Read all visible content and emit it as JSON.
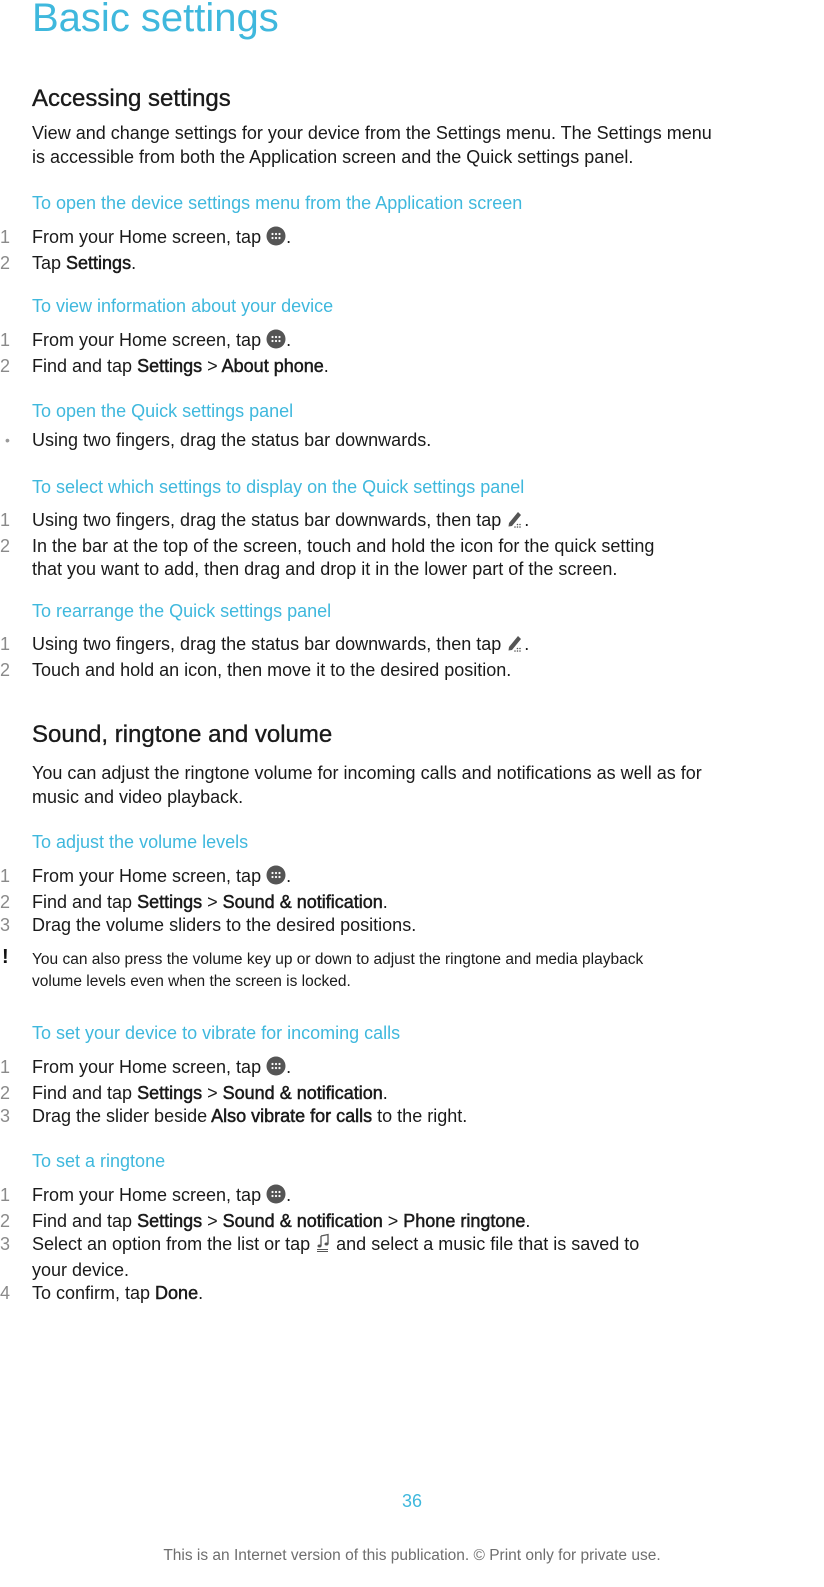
{
  "page": {
    "title": "Basic settings",
    "page_number": "36",
    "footer_note": "This is an Internet version of this publication. © Print only for private use."
  },
  "accessing": {
    "heading": "Accessing settings",
    "intro_line1": "View and change settings for your device from the Settings menu. The Settings menu",
    "intro_line2": "is accessible from both the Application screen and the Quick settings panel.",
    "procedures": [
      {
        "title": "To open the device settings menu from the Application screen",
        "steps": [
          {
            "num": "1",
            "text": "From your Home screen, tap ",
            "icon": "apps-grid-icon",
            "after": "."
          },
          {
            "num": "2",
            "pre": "Tap ",
            "bold": "Settings",
            "post": "."
          }
        ]
      },
      {
        "title": "To view information about your device",
        "steps": [
          {
            "num": "1",
            "text": "From your Home screen, tap ",
            "icon": "apps-grid-icon",
            "after": "."
          },
          {
            "num": "2",
            "pre": "Find and tap ",
            "bold": "Settings",
            "sep": " > ",
            "bold2": "About phone",
            "post": "."
          }
        ]
      },
      {
        "title": "To open the Quick settings panel",
        "bullet": "•",
        "steps": [
          {
            "text": "Using two fingers, drag the status bar downwards."
          }
        ]
      },
      {
        "title": "To select which settings to display on the Quick settings panel",
        "steps": [
          {
            "num": "1",
            "text": "Using two fingers, drag the status bar downwards, then tap ",
            "icon": "edit-pencil-icon",
            "after": "."
          },
          {
            "num": "2",
            "line1": "In the bar at the top of the screen, touch and hold the icon for the quick setting",
            "line2": "that you want to add, then drag and drop it in the lower part of the screen."
          }
        ]
      },
      {
        "title": "To rearrange the Quick settings panel",
        "steps": [
          {
            "num": "1",
            "text": "Using two fingers, drag the status bar downwards, then tap ",
            "icon": "edit-pencil-icon",
            "after": "."
          },
          {
            "num": "2",
            "text": "Touch and hold an icon, then move it to the desired position."
          }
        ]
      }
    ]
  },
  "sound": {
    "heading": "Sound, ringtone and volume",
    "intro_line1": "You can adjust the ringtone volume for incoming calls and notifications as well as for",
    "intro_line2": "music and video playback.",
    "procedures": [
      {
        "title": "To adjust the volume levels",
        "steps": [
          {
            "num": "1",
            "text": "From your Home screen, tap ",
            "icon": "apps-grid-icon",
            "after": "."
          },
          {
            "num": "2",
            "pre": "Find and tap ",
            "bold": "Settings",
            "sep": " > ",
            "bold2": "Sound & notification",
            "post": "."
          },
          {
            "num": "3",
            "text": "Drag the volume sliders to the desired positions."
          }
        ],
        "note": {
          "icon": "!",
          "line1": "You can also press the volume key up or down to adjust the ringtone and media playback",
          "line2": "volume levels even when the screen is locked."
        }
      },
      {
        "title": "To set your device to vibrate for incoming calls",
        "steps": [
          {
            "num": "1",
            "text": "From your Home screen, tap ",
            "icon": "apps-grid-icon",
            "after": "."
          },
          {
            "num": "2",
            "pre": "Find and tap ",
            "bold": "Settings",
            "sep": " > ",
            "bold2": "Sound & notification",
            "post": "."
          },
          {
            "num": "3",
            "pre": "Drag the slider beside ",
            "bold": "Also vibrate for calls",
            "post": " to the right."
          }
        ]
      },
      {
        "title": "To set a ringtone",
        "steps": [
          {
            "num": "1",
            "text": "From your Home screen, tap ",
            "icon": "apps-grid-icon",
            "after": "."
          },
          {
            "num": "2",
            "pre": "Find and tap ",
            "bold": "Settings",
            "sep": " > ",
            "bold2": "Sound & notification",
            "sep2": " > ",
            "bold3": "Phone ringtone",
            "post": "."
          },
          {
            "num": "3",
            "pre": "Select an option from the list or tap ",
            "icon": "music-file-icon",
            "post": " and select a music file that is saved to",
            "line2": "your device."
          },
          {
            "num": "4",
            "pre": "To confirm, tap ",
            "bold": "Done",
            "post": "."
          }
        ]
      }
    ]
  }
}
